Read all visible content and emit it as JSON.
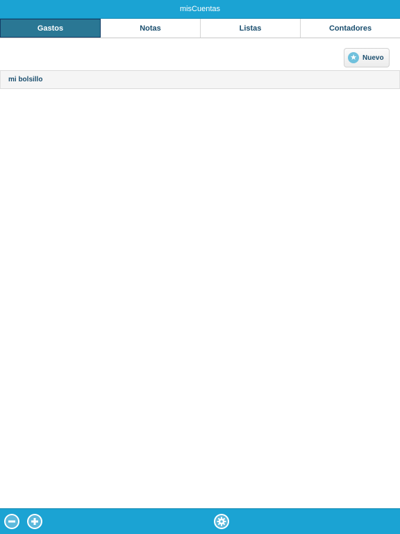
{
  "app": {
    "title": "misCuentas"
  },
  "tabs": [
    {
      "label": "Gastos",
      "active": true
    },
    {
      "label": "Notas",
      "active": false
    },
    {
      "label": "Listas",
      "active": false
    },
    {
      "label": "Contadores",
      "active": false
    }
  ],
  "actions": {
    "new_label": "Nuevo",
    "new_icon": "star-icon"
  },
  "list": {
    "items": [
      {
        "label": "mi bolsillo"
      }
    ]
  },
  "toolbar": {
    "buttons": [
      {
        "icon": "minus-circle-icon"
      },
      {
        "icon": "plus-circle-icon"
      },
      {
        "icon": "gear-icon"
      }
    ]
  },
  "colors": {
    "accent": "#1ba3d3",
    "active_tab": "#2a7794",
    "text": "#1a4e6e"
  }
}
